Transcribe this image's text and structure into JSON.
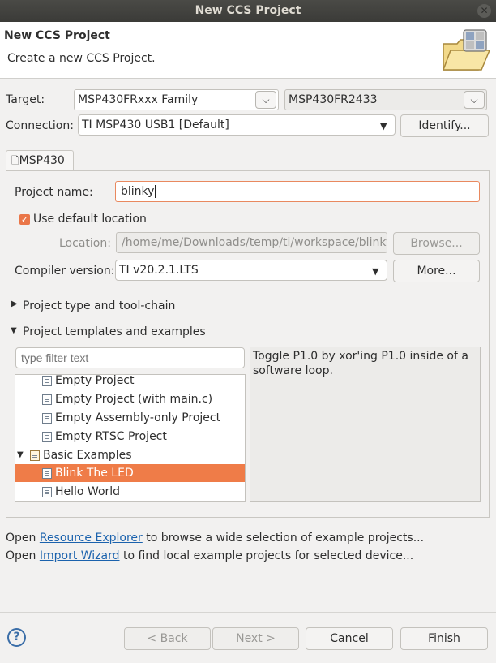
{
  "window": {
    "title": "New CCS Project"
  },
  "banner": {
    "title": "New CCS Project",
    "description": "Create a new CCS Project."
  },
  "target": {
    "label": "Target:",
    "family": "MSP430FRxxx Family",
    "device": "MSP430FR2433"
  },
  "connection": {
    "label": "Connection:",
    "value": "TI MSP430 USB1 [Default]",
    "identify_label": "Identify..."
  },
  "tab": {
    "label": "MSP430"
  },
  "project": {
    "name_label": "Project name:",
    "name_value": "blinky",
    "use_default_location_label": "Use default location",
    "use_default_location_checked": true,
    "location_label": "Location:",
    "location_value": "/home/me/Downloads/temp/ti/workspace/blinky",
    "browse_label": "Browse...",
    "compiler_label": "Compiler version:",
    "compiler_value": "TI v20.2.1.LTS",
    "more_label": "More..."
  },
  "sections": {
    "toolchain": "Project type and tool-chain",
    "templates": "Project templates and examples"
  },
  "templates": {
    "filter_placeholder": "type filter text",
    "items": [
      {
        "label": "Empty Project",
        "level": 1
      },
      {
        "label": "Empty Project (with main.c)",
        "level": 1
      },
      {
        "label": "Empty Assembly-only Project",
        "level": 1
      },
      {
        "label": "Empty RTSC Project",
        "level": 1
      },
      {
        "label": "Basic Examples",
        "level": 0,
        "expanded": true
      },
      {
        "label": "Blink The LED",
        "level": 1,
        "selected": true
      },
      {
        "label": "Hello World",
        "level": 1
      }
    ],
    "description": "Toggle P1.0 by xor'ing P1.0 inside of a software loop."
  },
  "footer_links": {
    "line1_prefix": "Open ",
    "line1_link": "Resource Explorer",
    "line1_suffix": " to browse a wide selection of example projects...",
    "line2_prefix": "Open ",
    "line2_link": "Import Wizard",
    "line2_suffix": " to find local example projects for selected device..."
  },
  "buttons": {
    "help": "?",
    "back": "< Back",
    "next": "Next >",
    "cancel": "Cancel",
    "finish": "Finish"
  },
  "colors": {
    "accent": "#ef7c48",
    "link": "#1b62ad",
    "titlebar": "#3e3e3b"
  }
}
